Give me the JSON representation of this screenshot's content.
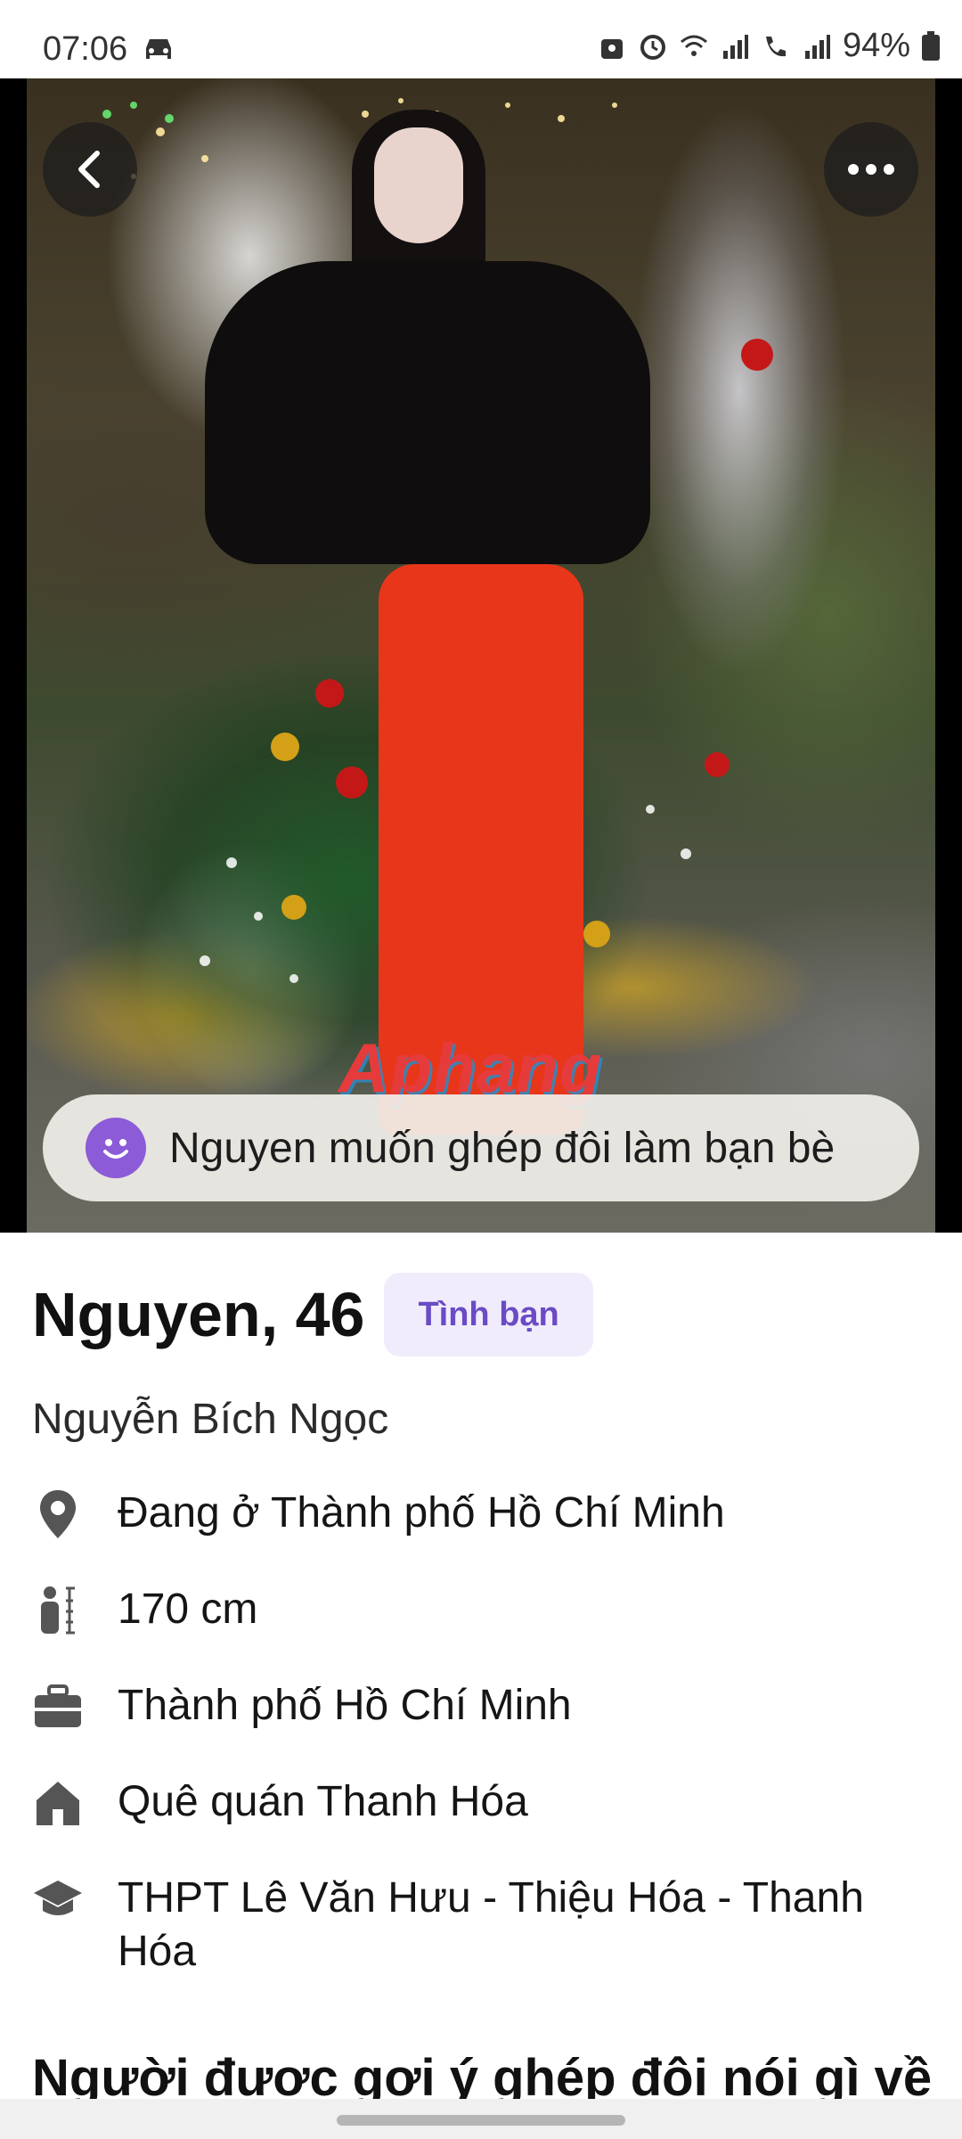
{
  "status_bar": {
    "time": "07:06",
    "battery": "94%",
    "icons": [
      "car-icon",
      "lock-icon",
      "alarm-icon",
      "wifi-icon",
      "signal-icon",
      "wifi-call-icon",
      "signal-icon",
      "battery-icon"
    ]
  },
  "photo": {
    "watermark": "Aphang",
    "back_icon": "chevron-left-icon",
    "more_icon": "more-horizontal-icon"
  },
  "match_banner": {
    "text": "Nguyen muốn ghép đôi làm bạn bè",
    "icon": "smiley-icon",
    "icon_color": "#8c5bd8"
  },
  "profile": {
    "name_age": "Nguyen, 46",
    "tag": "Tình bạn",
    "full_name": "Nguyễn Bích Ngọc",
    "info": [
      {
        "icon": "location-pin-icon",
        "text": "Đang ở Thành phố Hồ Chí Minh"
      },
      {
        "icon": "height-icon",
        "text": "170 cm"
      },
      {
        "icon": "briefcase-icon",
        "text": "Thành phố Hồ Chí Minh"
      },
      {
        "icon": "home-icon",
        "text": "Quê quán Thanh Hóa"
      },
      {
        "icon": "school-icon",
        "text": "THPT Lê Văn Hưu - Thiệu Hóa - Thanh Hóa"
      }
    ]
  },
  "section_title": "Người được gợi ý ghép đôi nói gì về",
  "colors": {
    "accent": "#8c5bd8",
    "tag_bg": "#f1ecfb",
    "tag_text": "#6a4bc4"
  }
}
